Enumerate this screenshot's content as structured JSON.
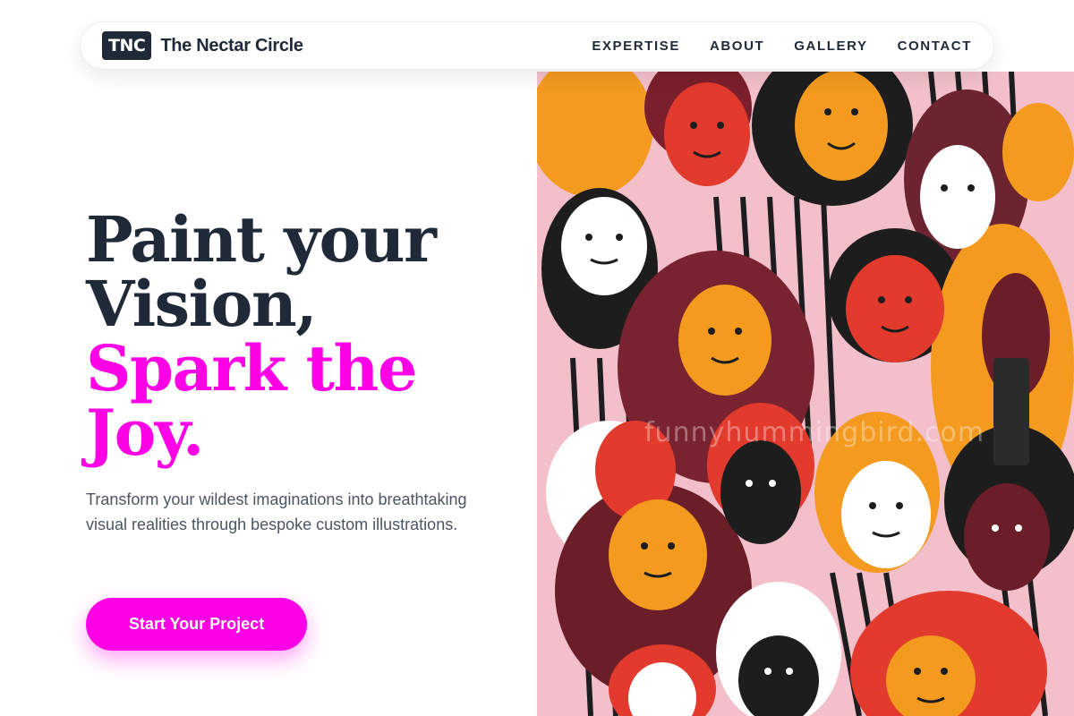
{
  "nav": {
    "logo_badge": "TNC",
    "brand_name": "The Nectar Circle",
    "links": [
      "EXPERTISE",
      "ABOUT",
      "GALLERY",
      "CONTACT"
    ]
  },
  "hero": {
    "title_line1": "Paint your",
    "title_line2": "Vision,",
    "title_line3": "Spark the",
    "title_line4": "Joy.",
    "subtitle": "Transform your wildest imaginations into breathtaking visual realities through bespoke custom illustrations.",
    "cta_label": "Start Your Project",
    "image_watermark": "funnyhummingbird.com"
  },
  "colors": {
    "accent": "#ff00e6",
    "text_dark": "#1f2937",
    "text_muted": "#4b5563"
  }
}
